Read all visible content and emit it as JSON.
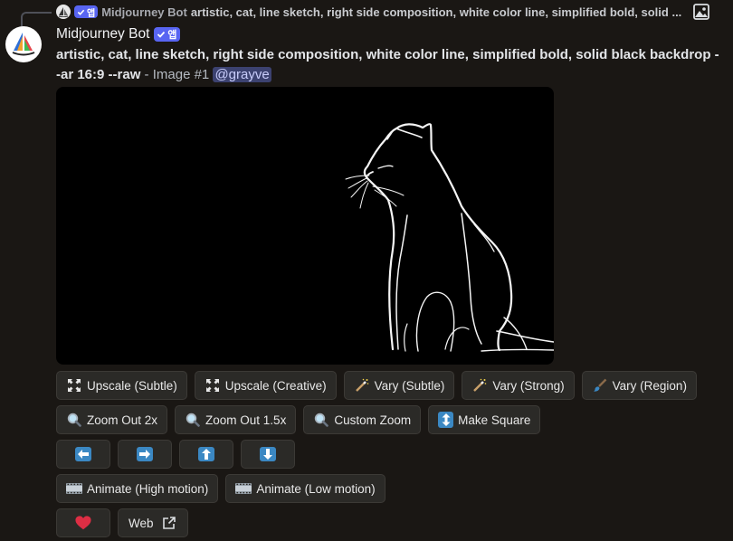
{
  "reply": {
    "author": "Midjourney Bot",
    "badge": "앱",
    "text": "artistic, cat, line sketch, right side composition, white color line, simplified bold, solid ..."
  },
  "message": {
    "author": "Midjourney Bot",
    "badge": "앱",
    "prompt_bold": "artistic, cat, line sketch, right side composition, white color line, simplified bold, solid black backdrop --ar 16:9 --raw",
    "separator": " - ",
    "image_label": "Image #1",
    "mention": "@grayve"
  },
  "buttons": {
    "row1": [
      "Upscale (Subtle)",
      "Upscale (Creative)",
      "Vary (Subtle)",
      "Vary (Strong)",
      "Vary (Region)"
    ],
    "row2": [
      "Zoom Out 2x",
      "Zoom Out 1.5x",
      "Custom Zoom",
      "Make Square"
    ],
    "row5_web": "Web"
  },
  "icons": {
    "upscale": "expand-arrows-icon",
    "vary": "magic-wand-icon",
    "region": "paintbrush-icon",
    "zoom": "magnifier-icon",
    "square": "up-down-arrow-icon",
    "pan": [
      "left-arrow-icon",
      "right-arrow-icon",
      "up-arrow-icon",
      "down-arrow-icon"
    ],
    "animate": "film-strip-icon",
    "heart": "heart-icon",
    "external": "external-link-icon"
  },
  "animate": [
    "Animate (High motion)",
    "Animate (Low motion)"
  ],
  "colors": {
    "accent": "#5865f2",
    "pan_button": "#3b88c3",
    "heart": "#dd2e44"
  }
}
